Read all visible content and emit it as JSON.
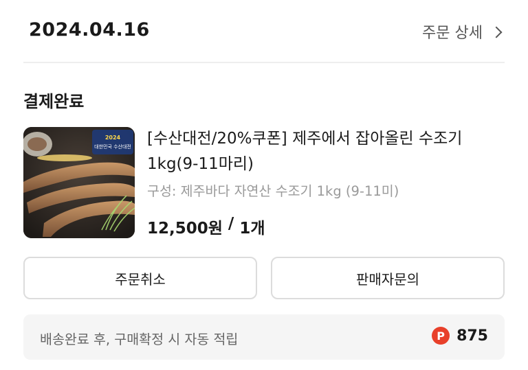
{
  "order": {
    "date": "2024.04.16",
    "detail_link": "주문 상세",
    "status": "결제완료"
  },
  "product": {
    "title": "[수산대전/20%쿠폰] 제주에서 잡아올린 수조기 1kg(9-11마리)",
    "option": "구성: 제주바다 자연산 수조기 1kg (9-11미)",
    "price": "12,500원",
    "separator": "/",
    "quantity": "1개",
    "image_badge": "2024 대한민국 수산대전"
  },
  "buttons": {
    "cancel": "주문취소",
    "inquiry": "판매자문의"
  },
  "points": {
    "description": "배송완료 후, 구매확정 시 자동 적립",
    "icon_label": "P",
    "value": "875",
    "icon_color": "#e8402a"
  }
}
